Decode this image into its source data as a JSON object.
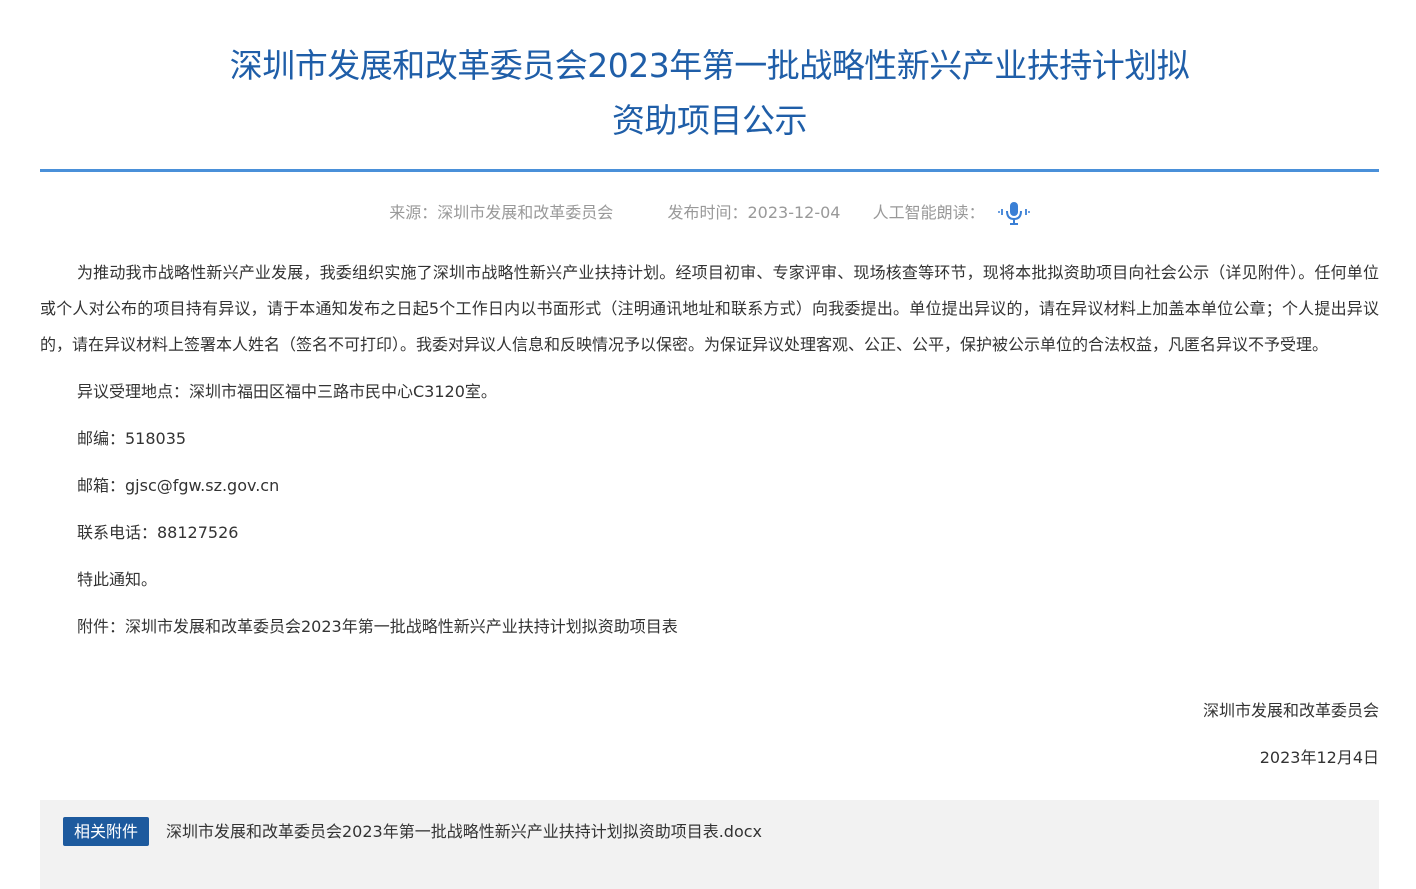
{
  "article": {
    "title_line1": "深圳市发展和改革委员会2023年第一批战略性新兴产业扶持计划拟",
    "title_line2": "资助项目公示",
    "source_label": "来源：",
    "source_value": "深圳市发展和改革委员会",
    "date_label": "发布时间：",
    "date_value": "2023-12-04",
    "tts_label": "人工智能朗读：",
    "tts_icon": "microphone-icon"
  },
  "body": {
    "intro": "为推动我市战略性新兴产业发展，我委组织实施了深圳市战略性新兴产业扶持计划。经项目初审、专家评审、现场核查等环节，现将本批拟资助项目向社会公示（详见附件）。任何单位或个人对公布的项目持有异议，请于本通知发布之日起5个工作日内以书面形式（注明通讯地址和联系方式）向我委提出。单位提出异议的，请在异议材料上加盖本单位公章；个人提出异议的，请在异议材料上签署本人姓名（签名不可打印）。我委对异议人信息和反映情况予以保密。为保证异议处理客观、公正、公平，保护被公示单位的合法权益，凡匿名异议不予受理。",
    "address": "异议受理地点：深圳市福田区福中三路市民中心C3120室。",
    "postcode": "邮编：518035",
    "email": "邮箱：gjsc@fgw.sz.gov.cn",
    "phone": "联系电话：88127526",
    "notice": "特此通知。",
    "attachment_line": "附件：深圳市发展和改革委员会2023年第一批战略性新兴产业扶持计划拟资助项目表",
    "signer": "深圳市发展和改革委员会",
    "sign_date": "2023年12月4日"
  },
  "attachments": {
    "badge": "相关附件",
    "file_name": "深圳市发展和改革委员会2023年第一批战略性新兴产业扶持计划拟资助项目表.docx"
  },
  "colors": {
    "title": "#1f5ea8",
    "rule": "#4a90d9",
    "meta_text": "#999999",
    "badge_bg": "#1d5a9e",
    "attach_bg": "#f2f2f2"
  }
}
